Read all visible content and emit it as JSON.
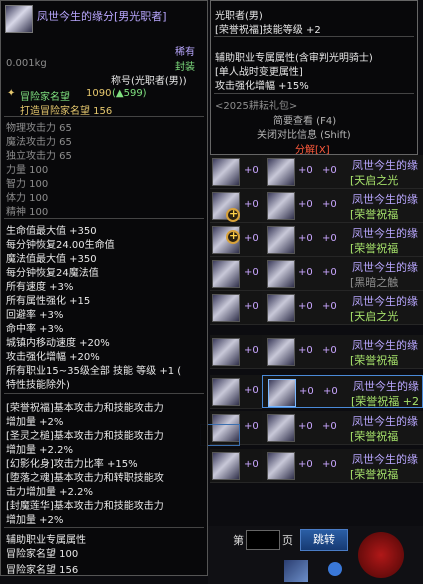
{
  "tooltip": {
    "title": "凤世今生的缘分[男光职者]",
    "rarity": "稀有",
    "weight": "0.001kg",
    "sealed": "封装",
    "title_type": "称号(光职者(男))",
    "adventurer_fame": "冒险家名望",
    "fame_value": "1090",
    "fame_delta": "(▲599)",
    "forge_fame": "打造冒险家名望 156",
    "base_stats": [
      "物理攻击力 65",
      "魔法攻击力 65",
      "独立攻击力 65",
      "力量 100",
      "智力 100",
      "体力 100",
      "精神 100"
    ],
    "effects": [
      "生命值最大值 +350",
      "每分钟恢复24.00生命值",
      "魔法值最大值 +350",
      "每分钟恢复24魔法值",
      "所有速度 +3%",
      "所有属性强化 +15",
      "回避率 +3%",
      "命中率 +3%",
      "城镇内移动速度 +20%",
      "攻击强化增幅 +20%",
      "所有职业15~35级全部 技能 等级 +1 (",
      "特性技能除外)"
    ],
    "buffs": [
      "[荣誉祝福]基本攻击力和技能攻击力",
      "增加量 +2%",
      "[圣灵之槌]基本攻击力和技能攻击力",
      "增加量 +2.2%",
      "[幻影化身]攻击力比率 +15%",
      "[堕落之魂]基本攻击力和转职技能攻",
      "击力增加量 +2.2%",
      "[封魔莲华]基本攻击力和技能攻击力",
      "增加量 +2%"
    ],
    "aux_title": "辅助职业专属属性",
    "aux_fame": "冒险家名望 100",
    "footer_fame": "冒险家名望 156"
  },
  "tooltip2": {
    "header": "光职者(男)",
    "skill": "[荣誉祝福]技能等级 +2",
    "aux_title": "辅助职业专属属性(含审判光明骑士)",
    "aux_cond": "[单人战时变更属性]",
    "aux_effect": "攻击强化增幅 +15%",
    "package": "<2025耕耘礼包>",
    "brief": "简要查看 (F4)",
    "compare": "关闭对比信息 (Shift)",
    "decompose": "分解[X]"
  },
  "list_rows": [
    {
      "name": "凤世今生的缘",
      "tag": "[天启之光",
      "p1": "+0",
      "p2": "+0"
    },
    {
      "name": "凤世今生的缘",
      "tag": "[荣誉祝福",
      "p1": "+0",
      "p2": "+0"
    },
    {
      "name": "凤世今生的缘",
      "tag": "[荣誉祝福",
      "p1": "+0",
      "p2": "+0"
    },
    {
      "name": "凤世今生的缘",
      "tag": "[黑暗之触",
      "p1": "+0",
      "p2": "+0"
    },
    {
      "name": "凤世今生的缘",
      "tag": "[天启之光",
      "p1": "+0",
      "p2": "+0"
    },
    {
      "name": "凤世今生的缘",
      "tag": "[荣誉祝福",
      "p1": "+0",
      "p2": "+0"
    },
    {
      "name": "凤世今生的缘",
      "tag": "[荣誉祝福 +2",
      "p1": "+0",
      "p2": "+0"
    },
    {
      "name": "凤世今生的缘",
      "tag": "[荣誉祝福",
      "p1": "+0",
      "p2": "+0"
    },
    {
      "name": "凤世今生的缘",
      "tag": "[荣誉祝福",
      "p1": "+0",
      "p2": "+0"
    }
  ],
  "pager": {
    "page_prefix": "第",
    "page_suffix": "页",
    "jump": "跳转"
  }
}
